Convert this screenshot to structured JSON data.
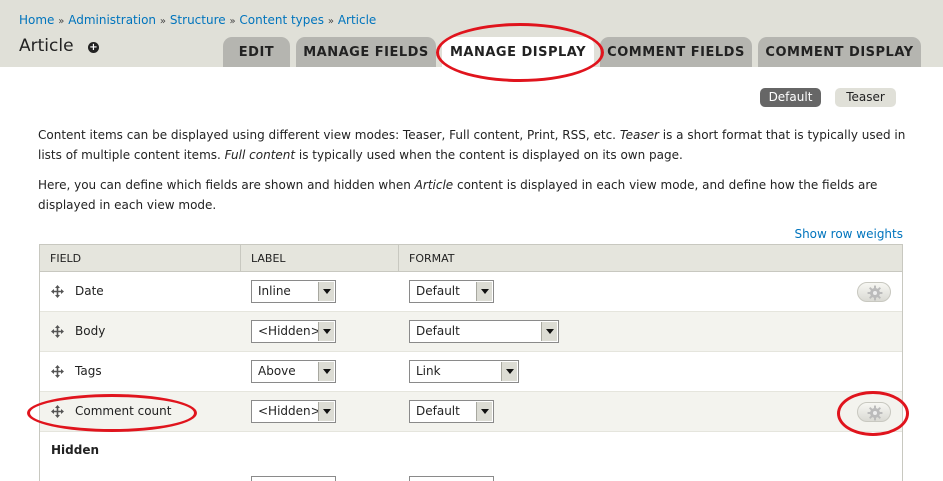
{
  "breadcrumb": {
    "items": [
      "Home",
      "Administration",
      "Structure",
      "Content types",
      "Article"
    ],
    "separator": "»"
  },
  "page": {
    "title": "Article"
  },
  "tabs": [
    {
      "label": "EDIT",
      "active": false
    },
    {
      "label": "MANAGE FIELDS",
      "active": false
    },
    {
      "label": "MANAGE DISPLAY",
      "active": true
    },
    {
      "label": "COMMENT FIELDS",
      "active": false
    },
    {
      "label": "COMMENT DISPLAY",
      "active": false
    }
  ],
  "view_modes": {
    "default": "Default",
    "teaser": "Teaser",
    "selected": "Default"
  },
  "description": {
    "p1_a": "Content items can be displayed using different view modes: Teaser, Full content, Print, RSS, etc. ",
    "p1_em1": "Teaser",
    "p1_b": " is a short format that is typically used in lists of multiple content items. ",
    "p1_em2": "Full content",
    "p1_c": " is typically used when the content is displayed on its own page.",
    "p2_a": "Here, you can define which fields are shown and hidden when ",
    "p2_em": "Article",
    "p2_b": " content is displayed in each view mode, and define how the fields are displayed in each view mode."
  },
  "show_row_weights": "Show row weights",
  "table": {
    "headers": {
      "field": "FIELD",
      "label": "LABEL",
      "format": "FORMAT"
    },
    "rows": [
      {
        "field": "Date",
        "label": "Inline",
        "format": "Default",
        "has_settings": true
      },
      {
        "field": "Body",
        "label": "<Hidden>",
        "format": "Default",
        "has_settings": false
      },
      {
        "field": "Tags",
        "label": "Above",
        "format": "Link",
        "has_settings": false
      },
      {
        "field": "Comment count",
        "label": "<Hidden>",
        "format": "Default",
        "has_settings": true
      }
    ],
    "hidden_section": "Hidden"
  },
  "colors": {
    "annotation_red": "#e0141d",
    "link_blue": "#0074bd",
    "header_bg": "#e0e0d8"
  }
}
